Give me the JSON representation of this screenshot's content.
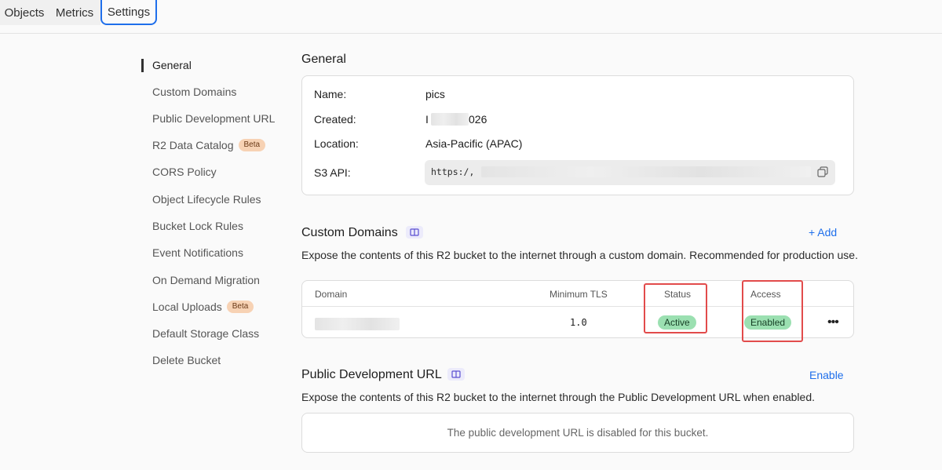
{
  "tabs": [
    {
      "label": "Objects"
    },
    {
      "label": "Metrics"
    },
    {
      "label": "Settings",
      "active": true
    }
  ],
  "sidebar": {
    "items": [
      {
        "label": "General",
        "active": true
      },
      {
        "label": "Custom Domains"
      },
      {
        "label": "Public Development URL"
      },
      {
        "label": "R2 Data Catalog",
        "badge": "Beta"
      },
      {
        "label": "CORS Policy"
      },
      {
        "label": "Object Lifecycle Rules"
      },
      {
        "label": "Bucket Lock Rules"
      },
      {
        "label": "Event Notifications"
      },
      {
        "label": "On Demand Migration"
      },
      {
        "label": "Local Uploads",
        "badge": "Beta"
      },
      {
        "label": "Default Storage Class"
      },
      {
        "label": "Delete Bucket"
      }
    ]
  },
  "general": {
    "title": "General",
    "name_label": "Name:",
    "name_value": "pics",
    "created_label": "Created:",
    "created_prefix": "I",
    "created_suffix": "026",
    "location_label": "Location:",
    "location_value": "Asia-Pacific (APAC)",
    "s3_label": "S3 API:",
    "s3_value": "https:/,"
  },
  "custom_domains": {
    "title": "Custom Domains",
    "add_label": "+ Add",
    "description": "Expose the contents of this R2 bucket to the internet through a custom domain. Recommended for production use.",
    "columns": [
      "Domain",
      "Minimum TLS",
      "Status",
      "Access"
    ],
    "rows": [
      {
        "domain": "",
        "min_tls": "1.0",
        "status": "Active",
        "access": "Enabled"
      }
    ],
    "more_label": "•••"
  },
  "public_dev_url": {
    "title": "Public Development URL",
    "enable_label": "Enable",
    "description": "Expose the contents of this R2 bucket to the internet through the Public Development URL when enabled.",
    "disabled_message": "The public development URL is disabled for this bucket."
  },
  "colors": {
    "accent": "#1f6feb",
    "badge_green": "#9be0b1",
    "beta_badge": "#f7d2b4",
    "highlight_red": "#e24b4b"
  },
  "icons": [
    "copy-icon",
    "book-icon",
    "plus-icon",
    "more-icon"
  ]
}
